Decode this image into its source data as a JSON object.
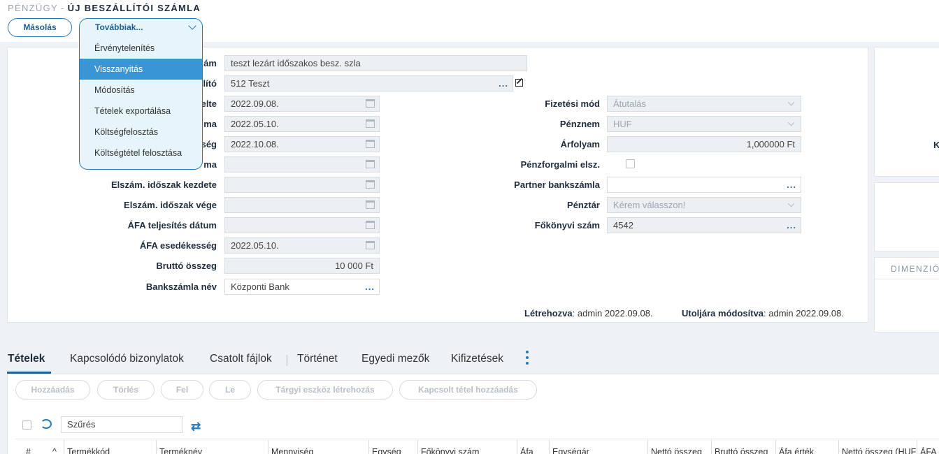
{
  "breadcrumb": {
    "parent": "PÉNZÜGY",
    "separator": "-",
    "title": "ÚJ BESZÁLLÍTÓI SZÁMLA"
  },
  "toolbar": {
    "copy_label": "Másolás",
    "more_label": "Továbbiak..."
  },
  "more_menu": {
    "items": [
      {
        "label": "Érvénytelenítés"
      },
      {
        "label": "Visszanyitás"
      },
      {
        "label": "Módosítás"
      },
      {
        "label": "Tételek exportálása"
      },
      {
        "label": "Költségfelosztás"
      },
      {
        "label": "Költségtétel felosztása"
      }
    ],
    "active_index": 1
  },
  "form": {
    "left": [
      {
        "label": "Számla szám",
        "label_visible": "ám",
        "value": "teszt lezárt időszakos besz. szla"
      },
      {
        "label": "Szállító",
        "label_visible": "lító",
        "value": "512 Teszt"
      },
      {
        "label": "Kelte",
        "label_visible": "elte",
        "value": "2022.09.08."
      },
      {
        "label": "Teljesítés dátuma",
        "label_visible": "ma",
        "value": "2022.05.10."
      },
      {
        "label": "Esedékesség",
        "label_visible": "ség",
        "value": "2022.10.08."
      },
      {
        "label": "dátuma",
        "label_visible": "ma",
        "value": ""
      },
      {
        "label": "Elszám. időszak kezdete",
        "value": ""
      },
      {
        "label": "Elszám. időszak vége",
        "value": ""
      },
      {
        "label": "ÁFA teljesítés dátum",
        "value": ""
      },
      {
        "label": "ÁFA esedékesség",
        "value": "2022.05.10."
      },
      {
        "label": "Bruttó összeg",
        "value": "10 000 Ft"
      },
      {
        "label": "Bankszámla név",
        "value": "Központi Bank"
      }
    ],
    "right": [
      {
        "label": "Fizetési mód",
        "value": "Átutalás"
      },
      {
        "label": "Pénznem",
        "value": "HUF"
      },
      {
        "label": "Árfolyam",
        "value": "1,000000 Ft"
      },
      {
        "label": "Pénzforgalmi elsz.",
        "value": ""
      },
      {
        "label": "Partner bankszámla",
        "value": ""
      },
      {
        "label": "Pénztár",
        "value": "Kérem válasszon!"
      },
      {
        "label": "Főkönyvi szám",
        "value": "4542"
      }
    ],
    "dots": "..."
  },
  "meta": {
    "created_label": "Létrehozva",
    "created_value": ": admin 2022.09.08.",
    "modified_label": "Utoljára módosítva",
    "modified_value": ": admin 2022.09.08."
  },
  "side": {
    "k_label": "K",
    "dimension_label": "DIMENZIÓ"
  },
  "tabs": [
    {
      "label": "Tételek",
      "active": true
    },
    {
      "label": "Kapcsolódó bizonylatok"
    },
    {
      "label": "Csatolt fájlok"
    },
    {
      "label": "Történet"
    },
    {
      "label": "Egyedi mezők"
    },
    {
      "label": "Kifizetések"
    }
  ],
  "items_toolbar": {
    "buttons": [
      "Hozzáadás",
      "Törlés",
      "Fel",
      "Le",
      "Tárgyi eszköz létrehozás",
      "Kapcsolt tétel hozzáadás"
    ],
    "filter_value": "Szűrés"
  },
  "grid": {
    "columns": [
      "#",
      "Termékkód",
      "Terméknév",
      "Mennyiség",
      "Egység",
      "Főkönyvi szám",
      "Áfa",
      "Egységár",
      "Nettó összeg",
      "Bruttó összeg",
      "Áfa érték",
      "Nettó összeg (HUF)",
      "ÁFA"
    ]
  },
  "colors": {
    "accent": "#2a7ab8",
    "menu_active": "#3a95d4",
    "menu_bg": "#e6f4fb"
  }
}
